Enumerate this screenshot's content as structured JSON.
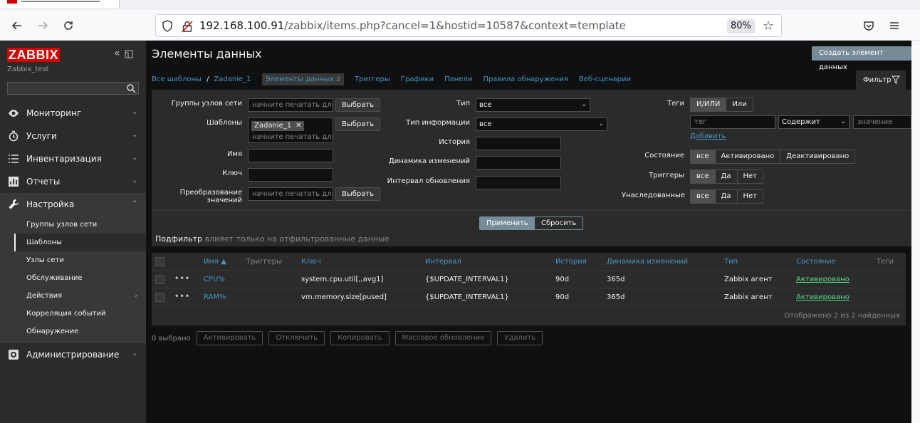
{
  "browser": {
    "url_host": "192.168.100.91",
    "url_path": "/zabbix/items.php?cancel=1&hostid=10587&context=template",
    "zoom": "80%"
  },
  "sidebar": {
    "logo": "ZABBIX",
    "server_name": "Zabbix_test",
    "menu": [
      {
        "label": "Мониторинг",
        "icon": "eye-icon"
      },
      {
        "label": "Услуги",
        "icon": "clock-icon"
      },
      {
        "label": "Инвентаризация",
        "icon": "list-icon"
      },
      {
        "label": "Отчеты",
        "icon": "chart-icon"
      },
      {
        "label": "Настройка",
        "icon": "wrench-icon"
      },
      {
        "label": "Администрирование",
        "icon": "gear-icon"
      }
    ],
    "submenu": [
      "Группы узлов сети",
      "Шаблоны",
      "Узлы сети",
      "Обслуживание",
      "Действия",
      "Корреляция событий",
      "Обнаружение"
    ]
  },
  "header": {
    "title": "Элементы данных",
    "create_button": "Создать элемент данных"
  },
  "tabs": {
    "all_templates": "Все шаблоны",
    "separator": "/",
    "template": "Zadanie_1",
    "items": "Элементы данных",
    "items_count": "2",
    "triggers": "Триггеры",
    "graphs": "Графики",
    "dashboards": "Панели",
    "discovery": "Правила обнаружения",
    "web": "Веб-сценарии",
    "filter": "Фильтр"
  },
  "filter": {
    "host_groups_label": "Группы узлов сети",
    "templates_label": "Шаблоны",
    "name_label": "Имя",
    "key_label": "Ключ",
    "valuemap_label": "Преобразование значений",
    "placeholder_type": "начните печатать для по",
    "select_button": "Выбрать",
    "template_chip": "Zadanie_1",
    "type_label": "Тип",
    "type_value": "все",
    "info_type_label": "Тип информации",
    "info_type_value": "все",
    "history_label": "История",
    "trends_label": "Динамика изменений",
    "interval_label": "Интервал обновления",
    "tags_label": "Теги",
    "tags_andor": "И/ИЛИ",
    "tags_or": "Или",
    "tag_placeholder": "тег",
    "tag_operator": "Содержит",
    "value_placeholder": "значение",
    "add_link": "Добавить",
    "state_label": "Состояние",
    "state_all": "все",
    "state_enabled": "Активировано",
    "state_disabled": "Деактивировано",
    "triggers_label": "Триггеры",
    "inherited_label": "Унаследованные",
    "all": "все",
    "yes": "Да",
    "no": "Нет",
    "apply": "Применить",
    "reset": "Сбросить",
    "subfilter_title": "Подфильтр",
    "subfilter_hint": "влияет только на отфильтрованные данные"
  },
  "table": {
    "columns": [
      "Имя ▲",
      "Триггеры",
      "Ключ",
      "Интервал",
      "История",
      "Динамика изменений",
      "Тип",
      "Состояние",
      "Теги"
    ],
    "rows": [
      {
        "name": "CPU%",
        "key": "system.cpu.util[,,avg1]",
        "interval": "{$UPDATE_INTERVAL1}",
        "history": "90d",
        "trends": "365d",
        "type": "Zabbix агент",
        "status": "Активировано"
      },
      {
        "name": "RAM%",
        "key": "vm.memory.size[pused]",
        "interval": "{$UPDATE_INTERVAL1}",
        "history": "90d",
        "trends": "365d",
        "type": "Zabbix агент",
        "status": "Активировано"
      }
    ],
    "footer": "Отображено 2 из 2 найденных",
    "more": "•••"
  },
  "bulk": {
    "selected": "0 выбрано",
    "activate": "Активировать",
    "disable": "Отключить",
    "copy": "Копировать",
    "mass_update": "Массовое обновление",
    "delete": "Удалить"
  },
  "colors": {
    "brand": "#d40000",
    "link": "#4796c4",
    "enabled": "#59db8f",
    "primary_button": "#768d99"
  }
}
